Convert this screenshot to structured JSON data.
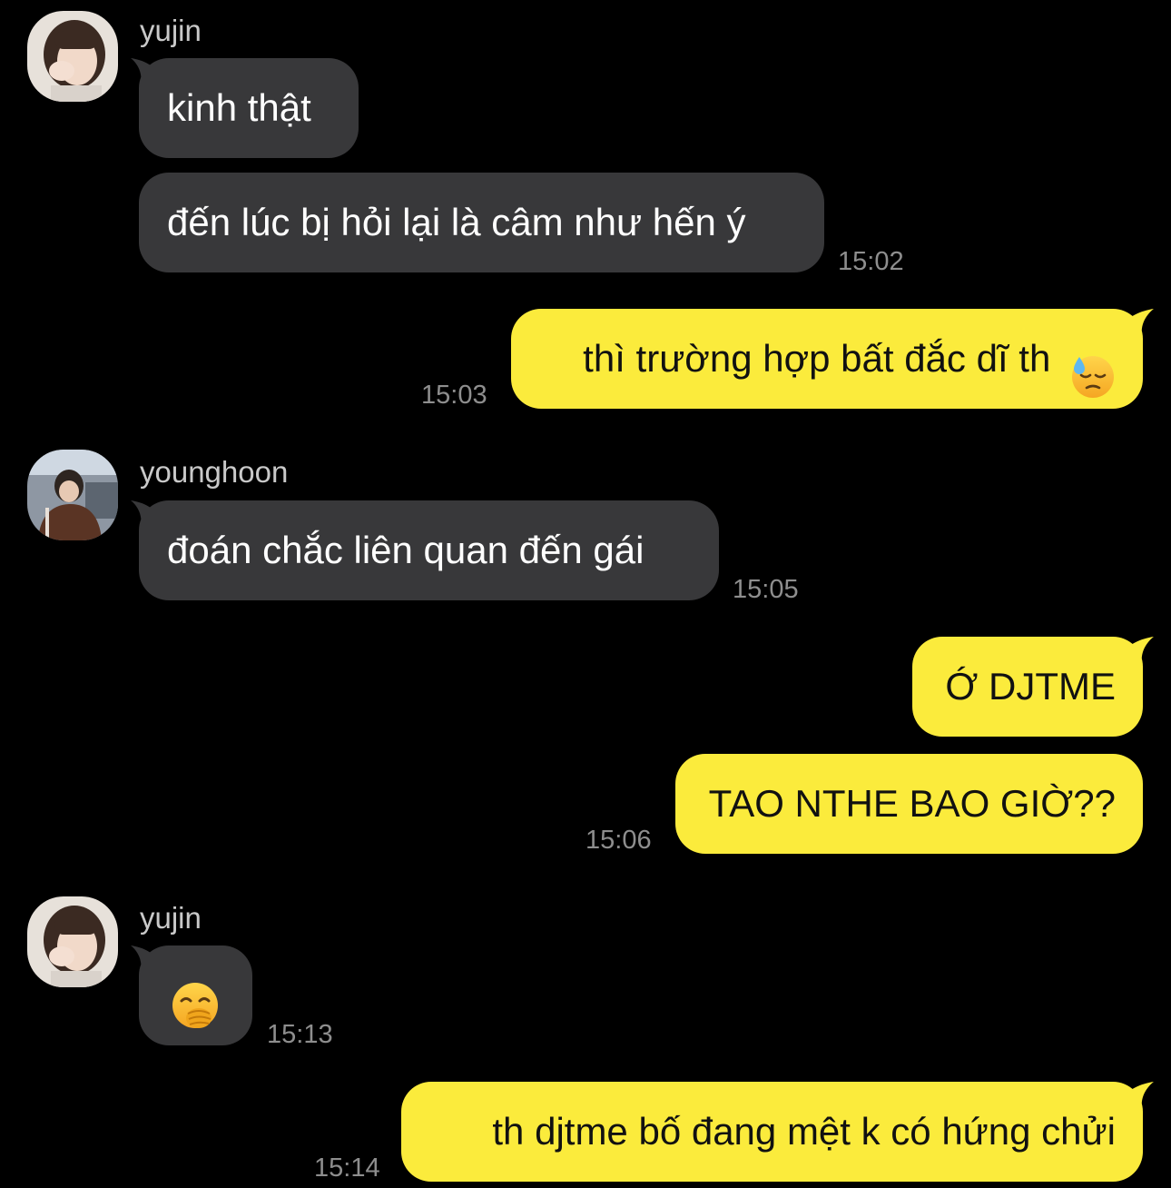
{
  "conversation": {
    "messages": [
      {
        "sender": "yujin",
        "text": "kinh thật"
      },
      {
        "text": "đến lúc bị hỏi lại là câm như hến ý",
        "time": "15:02"
      },
      {
        "text": "thì trường hợp bất đắc dĩ th",
        "emoji": "downcast-sweat-face-emoji",
        "time": "15:03"
      },
      {
        "sender": "younghoon",
        "text": "đoán chắc liên quan đến gái",
        "time": "15:05"
      },
      {
        "text": "Ớ DJTME"
      },
      {
        "text": "TAO NTHE BAO GIỜ??",
        "time": "15:06"
      },
      {
        "sender": "yujin",
        "emoji": "hand-over-mouth-face-emoji",
        "time": "15:13"
      },
      {
        "text": "th djtme bố đang mệt k có hứng chửi",
        "time": "15:14"
      }
    ]
  },
  "colors": {
    "background": "#000000",
    "incoming_bubble": "#38383a",
    "outgoing_bubble": "#fbeb3c",
    "sender_name": "#c9c9c9",
    "timestamp": "#8e8e8e"
  }
}
